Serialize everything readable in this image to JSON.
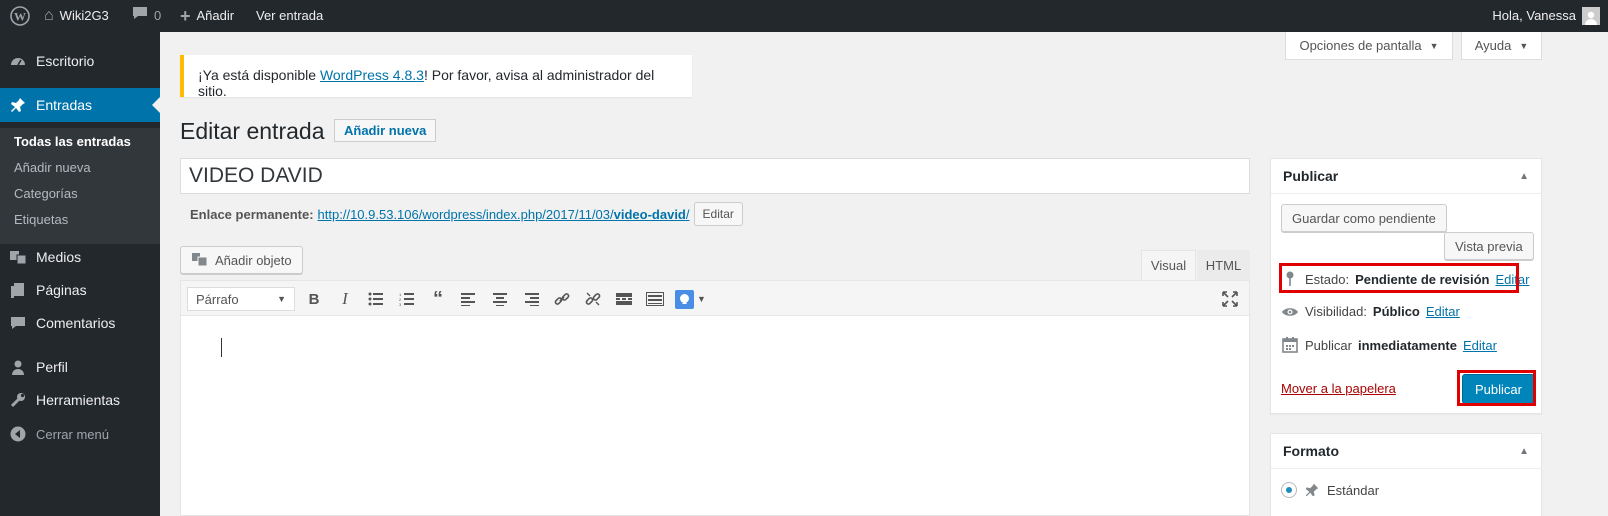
{
  "adminbar": {
    "site_name": "Wiki2G3",
    "comments_count": "0",
    "new_label": "Añadir",
    "view_label": "Ver entrada",
    "greeting": "Hola, Vanessa"
  },
  "sidebar": {
    "dashboard": "Escritorio",
    "posts": "Entradas",
    "posts_sub": [
      "Todas las entradas",
      "Añadir nueva",
      "Categorías",
      "Etiquetas"
    ],
    "media": "Medios",
    "pages": "Páginas",
    "comments": "Comentarios",
    "profile": "Perfil",
    "tools": "Herramientas",
    "collapse": "Cerrar menú"
  },
  "screen": {
    "options_label": "Opciones de pantalla",
    "help_label": "Ayuda"
  },
  "notice": {
    "prefix": "¡Ya está disponible ",
    "link": "WordPress 4.8.3",
    "suffix": "! Por favor, avisa al administrador del sitio."
  },
  "page": {
    "title": "Editar entrada",
    "add_new": "Añadir nueva"
  },
  "post": {
    "title": "VIDEO DAVID",
    "permalink_label": "Enlace permanente:",
    "permalink_base": "http://10.9.53.106/wordpress/index.php/2017/11/03/",
    "permalink_slug": "video-david",
    "permalink_trail": "/",
    "permalink_edit": "Editar"
  },
  "editor": {
    "add_media": "Añadir objeto",
    "tab_visual": "Visual",
    "tab_html": "HTML",
    "format_value": "Párrafo"
  },
  "publish_box": {
    "title": "Publicar",
    "save_pending": "Guardar como pendiente",
    "preview": "Vista previa",
    "status_label": "Estado:",
    "status_value": "Pendiente de revisión",
    "visibility_label": "Visibilidad:",
    "visibility_value": "Público",
    "publish_label": "Publicar",
    "publish_value": "inmediatamente",
    "edit": "Editar",
    "trash": "Mover a la papelera",
    "publish_button": "Publicar"
  },
  "format_box": {
    "title": "Formato",
    "option_standard": "Estándar"
  },
  "colors": {
    "primary": "#0085ba",
    "sidebar_bg": "#23282d",
    "active_menu": "#0073aa",
    "highlight": "#e00000",
    "notice_border": "#ffb900"
  }
}
